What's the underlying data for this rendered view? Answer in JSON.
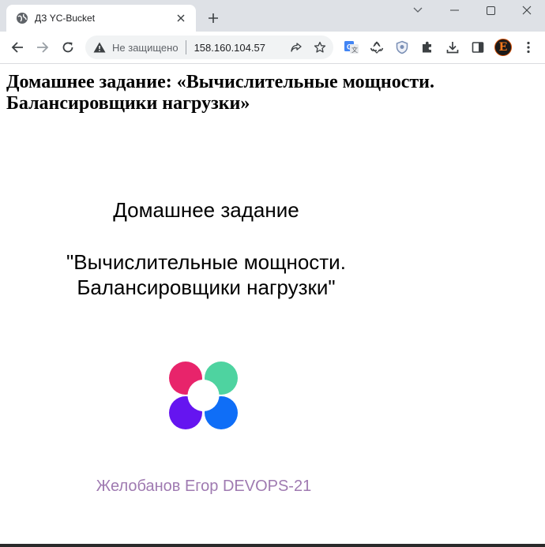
{
  "browser": {
    "tab": {
      "title": "ДЗ YC-Bucket",
      "favicon": "globe-icon",
      "close_icon": "close-icon"
    },
    "new_tab_icon": "plus-icon",
    "window_controls": [
      "chevron-down-icon",
      "minimize-icon",
      "maximize-icon",
      "close-icon"
    ],
    "nav": [
      "back-icon",
      "forward-icon",
      "reload-icon"
    ],
    "address_bar": {
      "security_label": "Не защищено",
      "security_icon": "warning-icon",
      "url": "158.160.104.57",
      "share_icon": "share-icon",
      "bookmark_icon": "star-icon"
    },
    "extensions": [
      "translate-icon",
      "recycle-icon",
      "shield-icon",
      "puzzle-icon",
      "download-icon",
      "sidepanel-icon"
    ],
    "profile": {
      "initial": "E"
    },
    "menu_icon": "kebab-menu-icon"
  },
  "page": {
    "heading": "Домашнее задание: «Вычислительные мощности. Балансировщики нагрузки»",
    "content_title": "Домашнее задание",
    "content_subtitle_line1": "\"Вычислительные мощности.",
    "content_subtitle_line2": "Балансировщики нагрузки\"",
    "logo": {
      "icon": "four-circle-logo",
      "colors": [
        "#e8246b",
        "#4ed3a0",
        "#6515f0",
        "#0f6ef7"
      ]
    },
    "author": "Желобанов Егор DEVOPS-21"
  }
}
